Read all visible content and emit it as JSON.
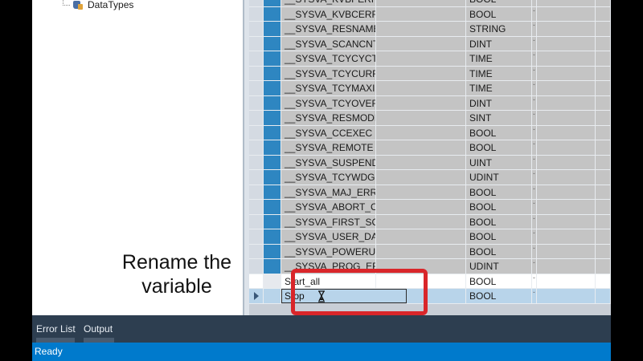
{
  "tree": {
    "item_label": "DataTypes",
    "item_icon": "database-icon"
  },
  "caption": {
    "line1": "Rename the",
    "line2": "variable"
  },
  "variables": [
    {
      "name": "__SYSVA_KVBPERR",
      "type": "BOOL"
    },
    {
      "name": "__SYSVA_KVBCERR",
      "type": "BOOL"
    },
    {
      "name": "__SYSVA_RESNAME",
      "type": "STRING"
    },
    {
      "name": "__SYSVA_SCANCNT",
      "type": "DINT"
    },
    {
      "name": "__SYSVA_TCYCYCTIM",
      "type": "TIME"
    },
    {
      "name": "__SYSVA_TCYCURREI",
      "type": "TIME"
    },
    {
      "name": "__SYSVA_TCYMAXIMU",
      "type": "TIME"
    },
    {
      "name": "__SYSVA_TCYOVERFL",
      "type": "DINT"
    },
    {
      "name": "__SYSVA_RESMODE",
      "type": "SINT"
    },
    {
      "name": "__SYSVA_CCEXEC",
      "type": "BOOL"
    },
    {
      "name": "__SYSVA_REMOTE",
      "type": "BOOL"
    },
    {
      "name": "__SYSVA_SUSPEND_I",
      "type": "UINT"
    },
    {
      "name": "__SYSVA_TCYWDG",
      "type": "UDINT"
    },
    {
      "name": "__SYSVA_MAJ_ERR_H",
      "type": "BOOL"
    },
    {
      "name": "__SYSVA_ABORT_CYC",
      "type": "BOOL"
    },
    {
      "name": "__SYSVA_FIRST_SCAI",
      "type": "BOOL"
    },
    {
      "name": "__SYSVA_USER_DATA",
      "type": "BOOL"
    },
    {
      "name": "__SYSVA_POWERUP_",
      "type": "BOOL"
    },
    {
      "name": "__SYSVA_PROG_ERR",
      "type": "UDINT"
    },
    {
      "name": "Start_all",
      "type": "BOOL"
    },
    {
      "name": "Stop",
      "type": "BOOL"
    }
  ],
  "dropdown_glyph": "ˇ",
  "dock": {
    "tabs": [
      "Error List",
      "Output"
    ]
  },
  "status": {
    "text": "Ready"
  },
  "colors": {
    "statusbar": "#007acc",
    "highlight": "#d9262a",
    "row_marker": "#2e86c1"
  }
}
